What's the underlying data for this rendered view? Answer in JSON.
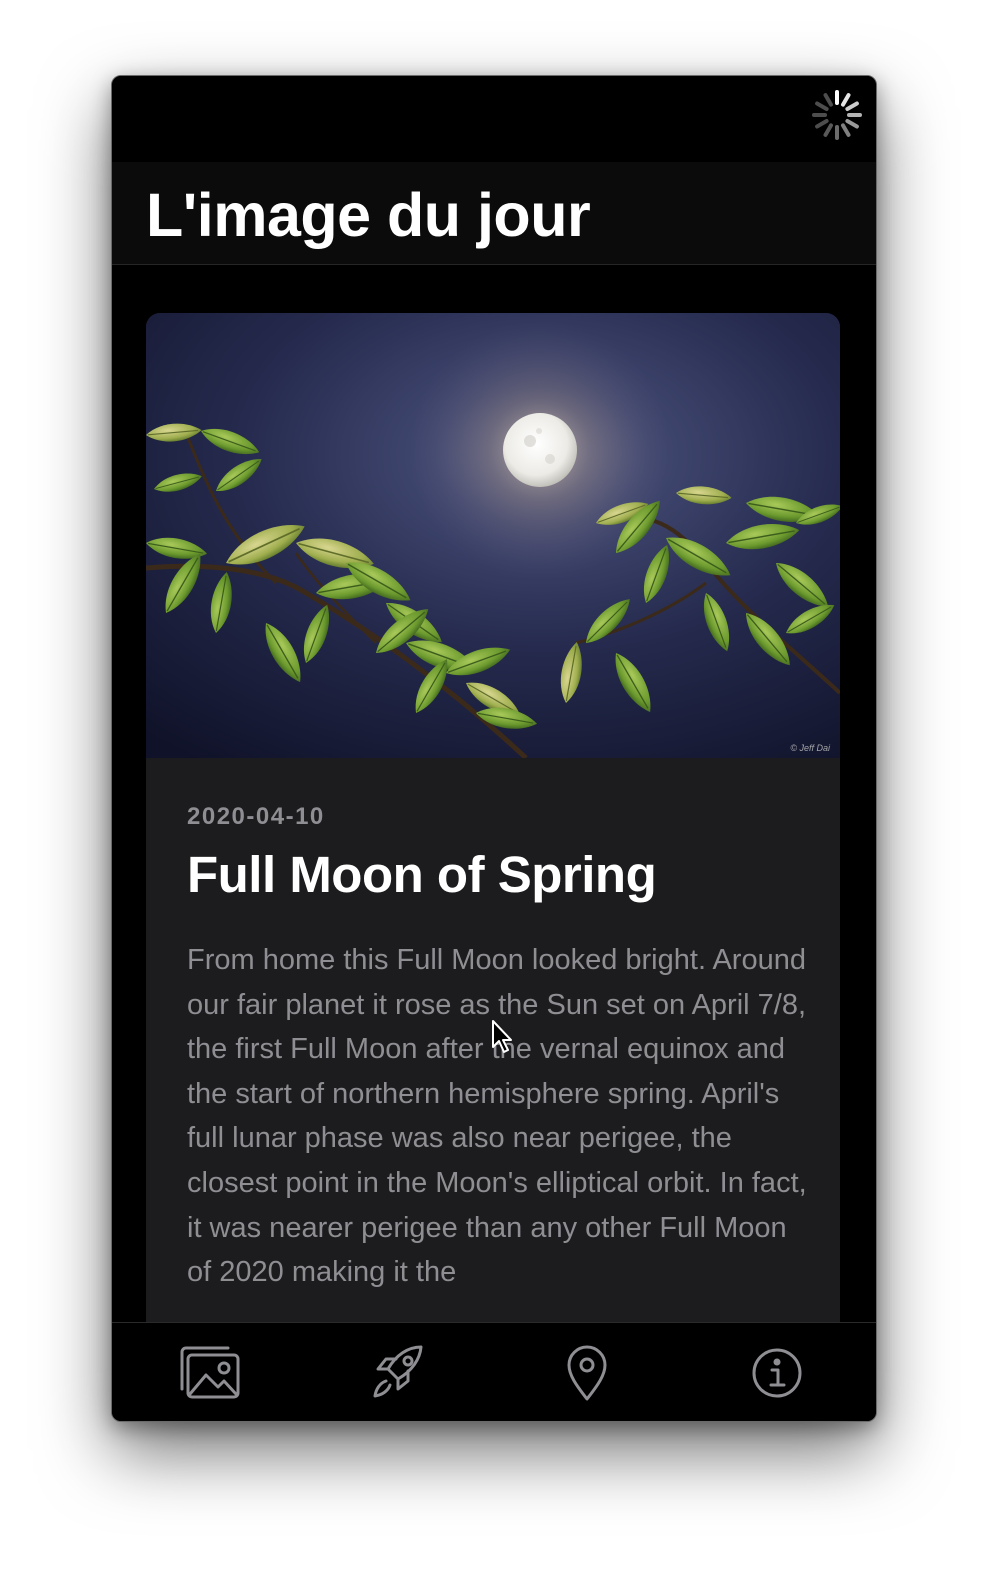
{
  "nav": {
    "title": "L'image du jour"
  },
  "article": {
    "date": "2020-04-10",
    "title": "Full Moon of Spring",
    "description": "From home this Full Moon looked bright. Around our fair planet it rose as the Sun set on April 7/8, the first Full Moon after the vernal equinox and the start of northern hemisphere spring. April's full lunar phase was also near perigee, the closest point in the Moon's elliptical orbit. In fact, it was nearer perigee than any other Full Moon of 2020 making it the",
    "image_credit": "© Jeff Dai"
  },
  "tabs": [
    {
      "icon": "photo-gallery-icon"
    },
    {
      "icon": "rocket-icon"
    },
    {
      "icon": "location-pin-icon"
    },
    {
      "icon": "info-icon"
    }
  ],
  "status": {
    "loading": true,
    "spinner_icon": "activity-spinner-icon"
  },
  "colors": {
    "background": "#000000",
    "card": "#1c1c1e",
    "secondary_text": "#8e8e93",
    "primary_text": "#ffffff",
    "tab_icon": "#8e8e93"
  }
}
